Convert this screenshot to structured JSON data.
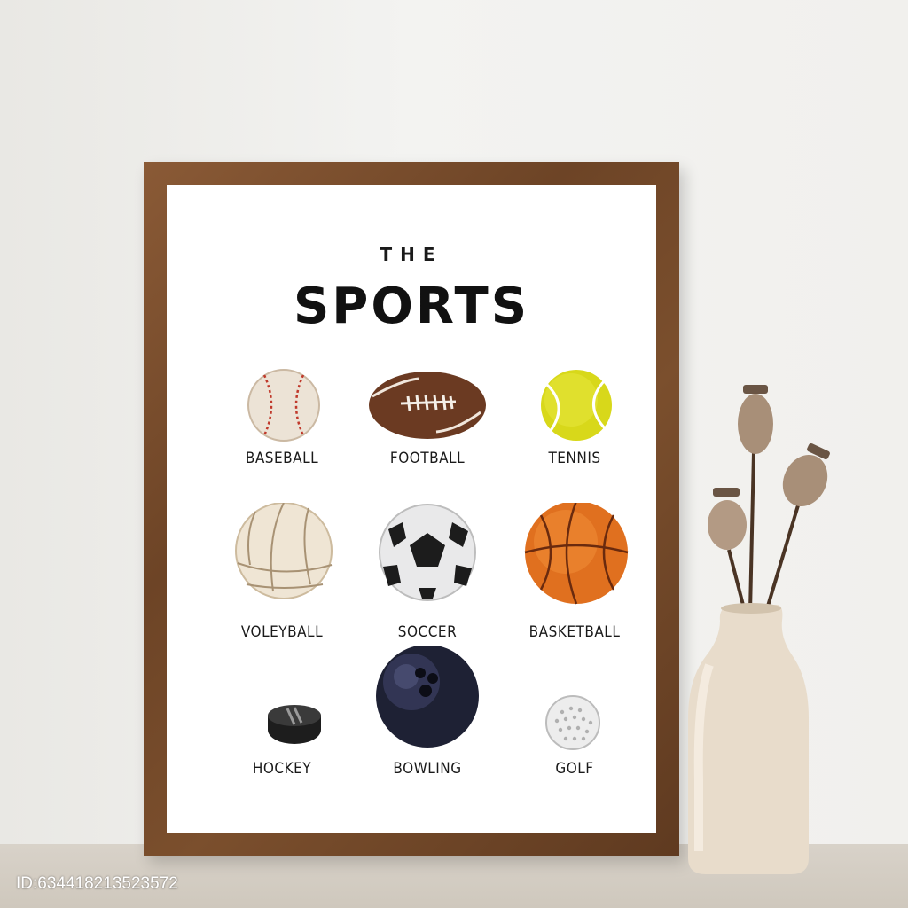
{
  "poster": {
    "title_small": "THE",
    "title_big": "SPORTS",
    "items": [
      {
        "label": "BASEBALL",
        "icon": "baseball-icon"
      },
      {
        "label": "FOOTBALL",
        "icon": "football-icon"
      },
      {
        "label": "TENNIS",
        "icon": "tennis-ball-icon"
      },
      {
        "label": "VOLEYBALL",
        "icon": "volleyball-icon"
      },
      {
        "label": "SOCCER",
        "icon": "soccer-ball-icon"
      },
      {
        "label": "BASKETBALL",
        "icon": "basketball-icon"
      },
      {
        "label": "HOCKEY",
        "icon": "hockey-puck-icon"
      },
      {
        "label": "BOWLING",
        "icon": "bowling-ball-icon"
      },
      {
        "label": "GOLF",
        "icon": "golf-ball-icon"
      }
    ]
  },
  "watermark": "ID:634418213523572",
  "colors": {
    "frame": "#7b4f2d",
    "poster_bg": "#ffffff",
    "text": "#111111",
    "vase": "#e8dccb"
  }
}
